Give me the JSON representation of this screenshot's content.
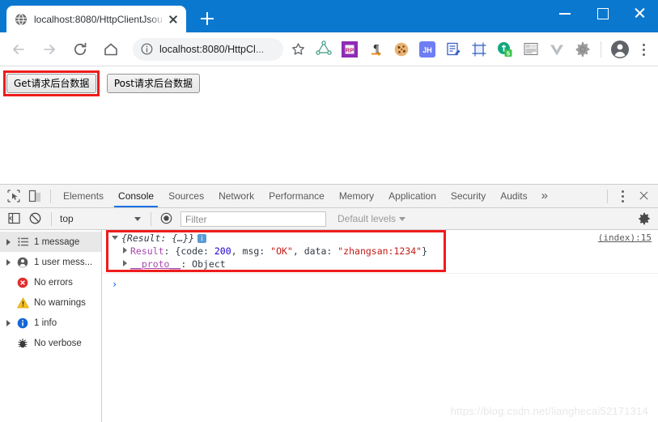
{
  "window": {
    "minimize_label": "Minimize",
    "maximize_label": "Maximize",
    "close_label": "Close"
  },
  "tabstrip": {
    "tabs": [
      {
        "title": "localhost:8080/HttpClientJsou",
        "favicon": "globe-icon",
        "close_label": "×"
      }
    ],
    "new_tab_label": "+"
  },
  "toolbar": {
    "back_label": "Back",
    "forward_label": "Forward",
    "reload_label": "Reload",
    "home_label": "Home",
    "omnibox": {
      "site_info_icon": "info-circle-icon",
      "url_main": "localhost:8080/HttpCl",
      "url_ellipsis": "...",
      "bookmark_icon": "star-icon"
    },
    "extensions": [
      {
        "name": "graphql-extension-icon",
        "label": ""
      },
      {
        "name": "rp-extension-icon",
        "label": "RP"
      },
      {
        "name": "pilcrow-extension-icon",
        "label": "¶"
      },
      {
        "name": "cookie-extension-icon",
        "label": ""
      },
      {
        "name": "jh-extension-icon",
        "label": "JH"
      },
      {
        "name": "notes-extension-icon",
        "label": ""
      },
      {
        "name": "frame-extension-icon",
        "label": ""
      },
      {
        "name": "evernote-extension-icon",
        "label": "5"
      },
      {
        "name": "clipboard-extension-icon",
        "label": ""
      },
      {
        "name": "vue-devtools-icon",
        "label": ""
      },
      {
        "name": "settings-extension-icon",
        "label": ""
      }
    ],
    "profile_label": "Profile",
    "menu_label": "Customize and control Google Chrome"
  },
  "page": {
    "buttons": [
      {
        "label": "Get请求后台数据",
        "highlighted": true
      },
      {
        "label": "Post请求后台数据",
        "highlighted": false
      }
    ],
    "watermark": "https://blog.csdn.net/lianghecai52171314"
  },
  "devtools": {
    "inspect_label": "Inspect element",
    "device_label": "Toggle device toolbar",
    "tabs": [
      {
        "label": "Elements",
        "active": false
      },
      {
        "label": "Console",
        "active": true
      },
      {
        "label": "Sources",
        "active": false
      },
      {
        "label": "Network",
        "active": false
      },
      {
        "label": "Performance",
        "active": false
      },
      {
        "label": "Memory",
        "active": false
      },
      {
        "label": "Application",
        "active": false
      },
      {
        "label": "Security",
        "active": false
      },
      {
        "label": "Audits",
        "active": false
      }
    ],
    "more_tabs_label": "»",
    "kebab_label": "More options",
    "close_label": "Close DevTools",
    "filterbar": {
      "sidebar_toggle_label": "Show console sidebar",
      "clear_label": "Clear console",
      "context": "top",
      "eye_label": "Live expressions",
      "filter_placeholder": "Filter",
      "levels_label": "Default levels",
      "settings_label": "Console settings"
    },
    "sidebar": [
      {
        "icon": "list-icon",
        "label": "1 message",
        "expandable": true,
        "selected": true
      },
      {
        "icon": "user-icon",
        "label": "1 user mess...",
        "expandable": true,
        "selected": false
      },
      {
        "icon": "error-icon",
        "label": "No errors",
        "expandable": false,
        "selected": false
      },
      {
        "icon": "warning-icon",
        "label": "No warnings",
        "expandable": false,
        "selected": false
      },
      {
        "icon": "info-icon",
        "label": "1 info",
        "expandable": true,
        "selected": false
      },
      {
        "icon": "bug-icon",
        "label": "No verbose",
        "expandable": false,
        "selected": false
      }
    ],
    "console": {
      "source_link": "(index):15",
      "preview": "{Result: {…}}",
      "info_badge": "i",
      "result_key": "Result",
      "result_sep": ": {",
      "code_key": "code: ",
      "code_value": "200",
      "comma1": ", ",
      "msg_key": "msg: ",
      "msg_value": "\"OK\"",
      "comma2": ", ",
      "data_key": "data: ",
      "data_value": "\"zhangsan:1234\"",
      "close_brace": "}",
      "proto_key": "__proto__",
      "proto_value": ": Object",
      "prompt": "›"
    }
  },
  "colors": {
    "chrome_blue": "#0b78d0",
    "accent_blue": "#1a73e8",
    "highlight_red": "#ef1c1c",
    "string_red": "#c41a16",
    "number_blue": "#1c00cf",
    "property_purple": "#a847b0"
  }
}
